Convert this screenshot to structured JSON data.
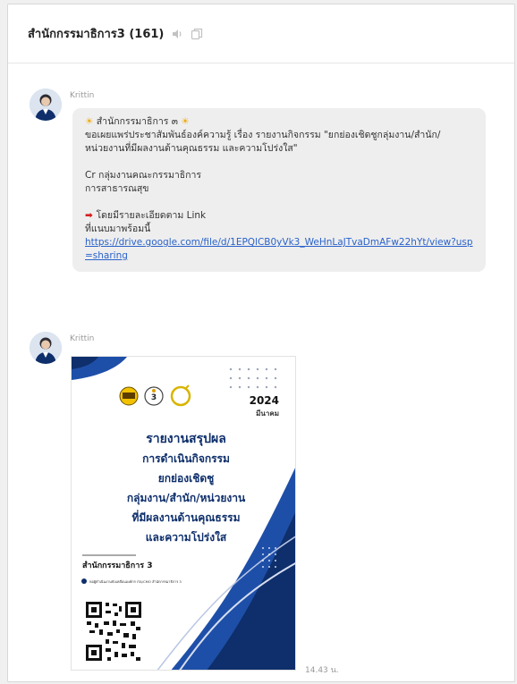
{
  "chat": {
    "title": "สำนักกรรมาธิการ3 (161)",
    "icons": [
      "mute-icon",
      "copy-icon"
    ]
  },
  "messages": [
    {
      "sender": "Krittin",
      "lines": [
        "สำนักกรรมาธิการ ๓",
        "ขอเผยแพร่ประชาสัมพันธ์องค์ความรู้ เรื่อง รายงานกิจกรรม \"ยกย่องเชิดชูกลุ่มงาน/สำนัก/",
        "หน่วยงานที่มีผลงานด้านคุณธรรม และความโปร่งใส\"",
        "Cr กลุ่มงานคณะกรรมาธิการ",
        "การสาธารณสุข",
        "โดยมีรายละเอียดตาม Link",
        "ที่แนบมาพร้อมนี้"
      ],
      "link": "https://drive.google.com/file/d/1EPQlCB0yVk3_WeHnLaJTvaDmAFw22hYt/view?usp=sharing"
    },
    {
      "sender": "Krittin",
      "time": "14.43 น.",
      "poster": {
        "year": "2024",
        "month": "มีนาคม",
        "badge": "3",
        "lines": [
          "รายงานสรุปผล",
          "การดำเนินกิจกรรม",
          "ยกย่องเชิดชู",
          "กลุ่มงาน/สำนัก/หน่วยงาน",
          "ที่มีผลงานด้านคุณธรรม",
          "และความโปร่งใส"
        ],
        "office": "สำนักกรรมาธิการ 3",
        "footer": "หอผู้ดำเนินงานขับเคลื่อนองค์กร ITA/CMO สำนักกรรมาธิการ 3"
      }
    }
  ],
  "colors": {
    "accent_blue": "#1e4fa8",
    "dark_blue": "#0e2f6b",
    "link": "#2a62c9",
    "bubble": "#eeeeef"
  }
}
